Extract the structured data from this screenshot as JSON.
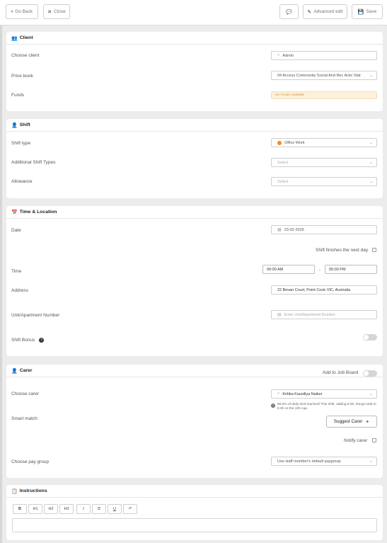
{
  "toolbar": {
    "go_back": "Go Back",
    "close": "Close",
    "advanced_edit": "Advanced edit",
    "save": "Save"
  },
  "client": {
    "title": "Client",
    "choose_client_label": "Choose client",
    "choose_client_value": "Admin",
    "price_book_label": "Price book",
    "price_book_value": "04 Access Community Social And Rec Activ Stat",
    "funds_label": "Funds",
    "funds_value": "No Funds Available"
  },
  "shift": {
    "title": "Shift",
    "shift_type_label": "Shift type",
    "shift_type_value": "Office Work",
    "shift_type_color": "#f08a24",
    "additional_label": "Additional Shift Types",
    "additional_placeholder": "Select",
    "allowance_label": "Allowance",
    "allowance_placeholder": "Select"
  },
  "time_location": {
    "title": "Time & Location",
    "date_label": "Date",
    "date_value": "23-02-2026",
    "next_day_label": "Shift finishes the next day",
    "time_label": "Time",
    "start_time": "09:00 AM",
    "time_separator": "-",
    "end_time": "05:00 PM",
    "address_label": "Address",
    "address_value": "22 Bevan Court, Point Cook VIC, Australia",
    "unit_label": "Unit/Apartment Number",
    "unit_placeholder": "Enter Unit/Apartment Number",
    "bonus_label": "Shift Bonus",
    "bonus_help": "?"
  },
  "carer": {
    "title": "Carer",
    "job_board_label": "Add to Job Board",
    "choose_carer_label": "Choose carer",
    "choose_carer_value": "Kritika Kausiliya Naiker",
    "limit_note": "80.0% of daily limit reached! This shift, adding 8.0h, brings total to 8.0h vs the 10h cap.",
    "smart_match_label": "Smart match",
    "suggest_button": "Suggest Carer",
    "notify_label": "Notify carer",
    "pay_group_label": "Choose pay group",
    "pay_group_value": "Use staff member's default paygroup"
  },
  "instructions": {
    "title": "Instructions",
    "tools": [
      "B",
      "H1",
      "H2",
      "H3",
      "I",
      "☰",
      "U",
      "↶"
    ]
  }
}
